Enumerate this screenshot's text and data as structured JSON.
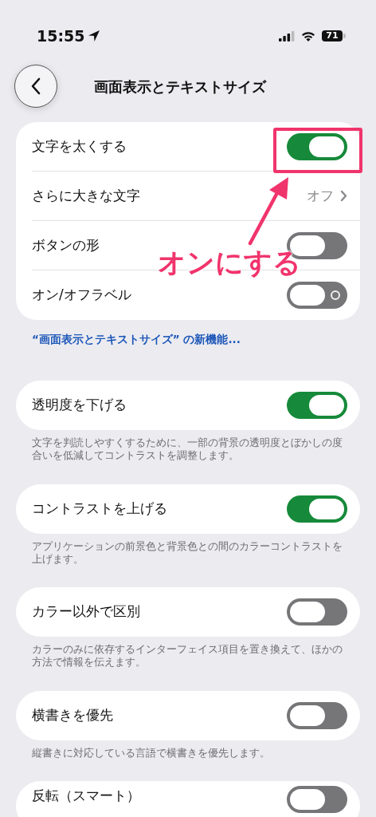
{
  "status_bar": {
    "time": "15:55",
    "battery": "71"
  },
  "header": {
    "title": "画面表示とテキストサイズ"
  },
  "groups": [
    {
      "rows": [
        {
          "kind": "toggle",
          "label": "文字を太くする",
          "on": true
        },
        {
          "kind": "link",
          "label": "さらに大きな文字",
          "value": "オフ"
        },
        {
          "kind": "toggle",
          "label": "ボタンの形",
          "on": false
        },
        {
          "kind": "toggle",
          "label": "オン/オフラベル",
          "on": false,
          "label_mark": true
        }
      ],
      "footer_link": "“画面表示とテキストサイズ” の新機能..."
    },
    {
      "rows": [
        {
          "kind": "toggle",
          "label": "透明度を下げる",
          "on": true
        }
      ],
      "footnote": "文字を判読しやすくするために、一部の背景の透明度とぼかしの度合いを低減してコントラストを調整します。"
    },
    {
      "rows": [
        {
          "kind": "toggle",
          "label": "コントラストを上げる",
          "on": true
        }
      ],
      "footnote": "アプリケーションの前景色と背景色との間のカラーコントラストを上げます。"
    },
    {
      "rows": [
        {
          "kind": "toggle",
          "label": "カラー以外で区別",
          "on": false
        }
      ],
      "footnote": "カラーのみに依存するインターフェイス項目を置き換えて、ほかの方法で情報を伝えます。"
    },
    {
      "rows": [
        {
          "kind": "toggle",
          "label": "横書きを優先",
          "on": false
        }
      ],
      "footnote": "縦書きに対応している言語で横書きを優先します。"
    },
    {
      "rows": [
        {
          "kind": "toggle",
          "label": "反転（スマート）",
          "on": false
        }
      ]
    }
  ],
  "annotation": {
    "text": "オンにする"
  }
}
